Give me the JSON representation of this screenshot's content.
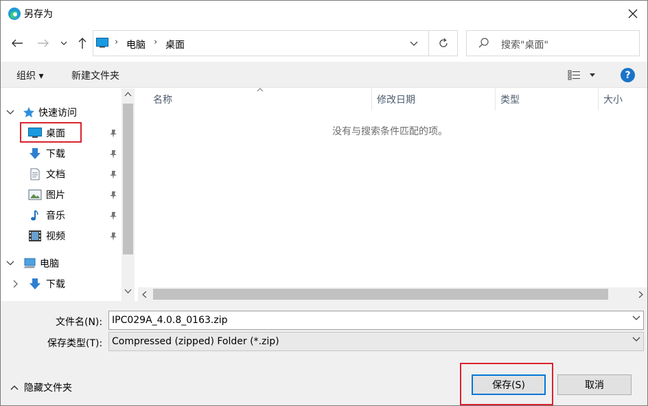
{
  "window": {
    "title": "另存为"
  },
  "nav": {
    "breadcrumb": [
      "电脑",
      "桌面"
    ],
    "search_placeholder": "搜索\"桌面\""
  },
  "toolbar": {
    "organize": "组织 ▾",
    "new_folder": "新建文件夹",
    "help": "?"
  },
  "tree": {
    "quick_access": "快速访问",
    "items": [
      {
        "label": "桌面",
        "icon": "desktop-icon",
        "selected": true
      },
      {
        "label": "下载",
        "icon": "download-arrow-icon"
      },
      {
        "label": "文档",
        "icon": "document-icon"
      },
      {
        "label": "图片",
        "icon": "picture-icon"
      },
      {
        "label": "音乐",
        "icon": "music-note-icon"
      },
      {
        "label": "视频",
        "icon": "video-icon"
      }
    ],
    "pc": "电脑",
    "pc_items": [
      {
        "label": "下载",
        "icon": "download-arrow-icon"
      }
    ]
  },
  "columns": [
    "名称",
    "修改日期",
    "类型",
    "大小"
  ],
  "empty_message": "没有与搜索条件匹配的项。",
  "form": {
    "filename_label": "文件名(N):",
    "filename_value": "IPC029A_4.0.8_0163.zip",
    "filetype_label": "保存类型(T):",
    "filetype_value": "Compressed (zipped) Folder (*.zip)"
  },
  "footer": {
    "hide_folders": "隐藏文件夹",
    "save": "保存(S)",
    "cancel": "取消"
  },
  "colors": {
    "accent": "#0078d7",
    "highlight": "#d9232d",
    "folder_blue": "#1a73c8"
  }
}
